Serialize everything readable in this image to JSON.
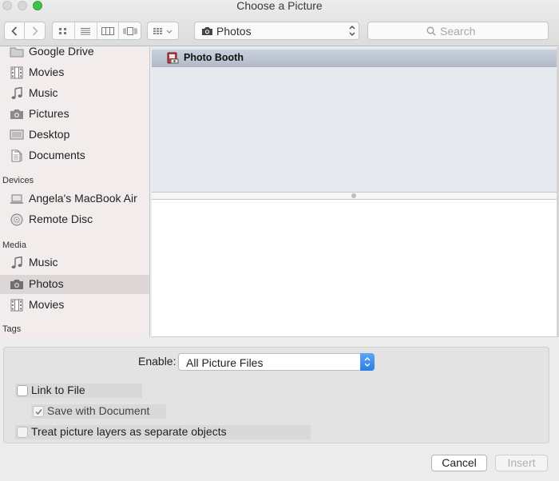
{
  "window": {
    "title": "Choose a Picture"
  },
  "toolbar": {
    "location": "Photos",
    "search_placeholder": "Search"
  },
  "sidebar": {
    "favorites": [
      {
        "label": "Google Drive",
        "icon": "folder-icon"
      },
      {
        "label": "Movies",
        "icon": "film-icon"
      },
      {
        "label": "Music",
        "icon": "music-note-icon"
      },
      {
        "label": "Pictures",
        "icon": "camera-icon"
      },
      {
        "label": "Desktop",
        "icon": "desktop-icon"
      },
      {
        "label": "Documents",
        "icon": "documents-icon"
      }
    ],
    "devices_header": "Devices",
    "devices": [
      {
        "label": "Angela's MacBook Air",
        "icon": "laptop-icon"
      },
      {
        "label": "Remote Disc",
        "icon": "disc-icon"
      }
    ],
    "media_header": "Media",
    "media": [
      {
        "label": "Music",
        "icon": "music-note-icon"
      },
      {
        "label": "Photos",
        "icon": "camera-icon",
        "selected": true
      },
      {
        "label": "Movies",
        "icon": "film-icon"
      }
    ],
    "tags_header": "Tags"
  },
  "browser": {
    "items": [
      {
        "label": "Photo Booth",
        "icon": "photo-booth-icon"
      }
    ]
  },
  "options": {
    "enable_label": "Enable:",
    "enable_value": "All Picture Files",
    "link_to_file": {
      "label": "Link to File",
      "checked": false
    },
    "save_with_document": {
      "label": "Save with Document",
      "checked": true,
      "enabled": false
    },
    "treat_layers": {
      "label": "Treat picture layers as separate objects",
      "checked": false
    }
  },
  "buttons": {
    "cancel": "Cancel",
    "insert": "Insert"
  },
  "colors": {
    "accent": "#2a7ee6",
    "selection": "#b9c1cf",
    "close": "#d8d8d8",
    "maximize": "#3fc14b"
  }
}
